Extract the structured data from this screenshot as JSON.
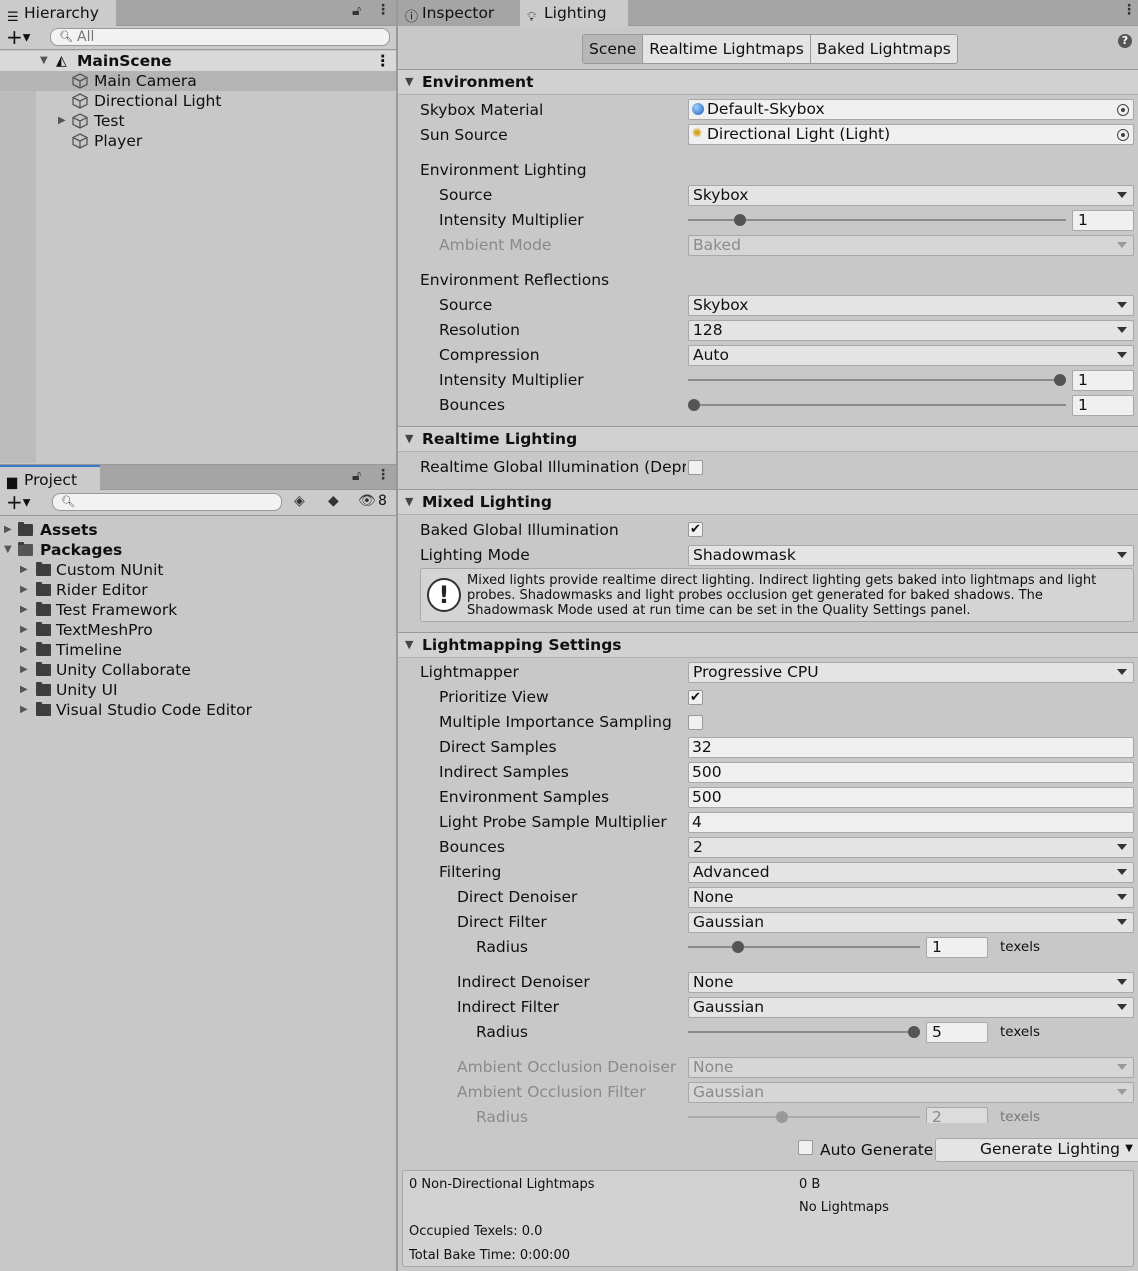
{
  "hierarchy": {
    "tab_label": "Hierarchy",
    "search_placeholder": "All",
    "scene_name": "MainScene",
    "items": [
      {
        "label": "Main Camera"
      },
      {
        "label": "Directional Light"
      },
      {
        "label": "Test"
      },
      {
        "label": "Player"
      }
    ]
  },
  "project": {
    "tab_label": "Project",
    "hidden_count": "8",
    "assets_label": "Assets",
    "packages_label": "Packages",
    "packages": [
      {
        "label": "Custom NUnit"
      },
      {
        "label": "Rider Editor"
      },
      {
        "label": "Test Framework"
      },
      {
        "label": "TextMeshPro"
      },
      {
        "label": "Timeline"
      },
      {
        "label": "Unity Collaborate"
      },
      {
        "label": "Unity UI"
      },
      {
        "label": "Visual Studio Code Editor"
      }
    ]
  },
  "tabs": {
    "inspector": "Inspector",
    "lighting": "Lighting"
  },
  "subtabs": [
    "Scene",
    "Realtime Lightmaps",
    "Baked Lightmaps"
  ],
  "help_glyph": "?",
  "environment": {
    "header": "Environment",
    "skybox_material_label": "Skybox Material",
    "skybox_material_value": "Default-Skybox",
    "sun_source_label": "Sun Source",
    "sun_source_value": "Directional Light (Light)",
    "env_lighting_label": "Environment Lighting",
    "source_label": "Source",
    "source_value": "Skybox",
    "intensity_label": "Intensity Multiplier",
    "intensity_value": "1",
    "intensity_fraction": 0.125,
    "ambient_mode_label": "Ambient Mode",
    "ambient_mode_value": "Baked",
    "env_reflections_label": "Environment Reflections",
    "refl_source_label": "Source",
    "refl_source_value": "Skybox",
    "resolution_label": "Resolution",
    "resolution_value": "128",
    "compression_label": "Compression",
    "compression_value": "Auto",
    "refl_intensity_label": "Intensity Multiplier",
    "refl_intensity_value": "1",
    "refl_intensity_fraction": 1.0,
    "bounces_label": "Bounces",
    "bounces_value": "1",
    "bounces_fraction": 0.0
  },
  "realtime": {
    "header": "Realtime Lighting",
    "gi_label": "Realtime Global Illumination (Deprec",
    "gi_checked": false
  },
  "mixed": {
    "header": "Mixed Lighting",
    "baked_gi_label": "Baked Global Illumination",
    "baked_gi_checked": true,
    "lighting_mode_label": "Lighting Mode",
    "lighting_mode_value": "Shadowmask",
    "help_icon_glyph": "!",
    "help_text": "Mixed lights provide realtime direct lighting. Indirect lighting gets baked into lightmaps and light probes. Shadowmasks and light probes occlusion get generated for baked shadows. The Shadowmask Mode used at run time can be set in the Quality Settings panel."
  },
  "lightmapping": {
    "header": "Lightmapping Settings",
    "lightmapper_label": "Lightmapper",
    "lightmapper_value": "Progressive CPU",
    "prioritize_label": "Prioritize View",
    "prioritize_checked": true,
    "mis_label": "Multiple Importance Sampling",
    "mis_checked": false,
    "direct_samples_label": "Direct Samples",
    "direct_samples_value": "32",
    "indirect_samples_label": "Indirect Samples",
    "indirect_samples_value": "500",
    "env_samples_label": "Environment Samples",
    "env_samples_value": "500",
    "probe_mult_label": "Light Probe Sample Multiplier",
    "probe_mult_value": "4",
    "bounces_label": "Bounces",
    "bounces_value": "2",
    "filtering_label": "Filtering",
    "filtering_value": "Advanced",
    "direct_denoiser_label": "Direct Denoiser",
    "direct_denoiser_value": "None",
    "direct_filter_label": "Direct Filter",
    "direct_filter_value": "Gaussian",
    "radius_label": "Radius",
    "direct_radius_value": "1",
    "direct_radius_fraction": 0.2,
    "texels_label": "texels",
    "indirect_denoiser_label": "Indirect Denoiser",
    "indirect_denoiser_value": "None",
    "indirect_filter_label": "Indirect Filter",
    "indirect_filter_value": "Gaussian",
    "indirect_radius_value": "5",
    "indirect_radius_fraction": 1.0,
    "ao_denoiser_label": "Ambient Occlusion Denoiser",
    "ao_denoiser_value": "None",
    "ao_filter_label": "Ambient Occlusion Filter",
    "ao_filter_value": "Gaussian",
    "ao_radius_value": "2",
    "ao_radius_fraction": 0.4
  },
  "bottom": {
    "auto_generate_label": "Auto Generate",
    "auto_generate_checked": false,
    "generate_label": "Generate Lighting"
  },
  "stats": {
    "lightmaps": "0 Non-Directional Lightmaps",
    "size": "0 B",
    "no_lightmaps": "No Lightmaps",
    "occupied": "Occupied Texels: 0.0",
    "bake_time": "Total Bake Time: 0:00:00"
  }
}
